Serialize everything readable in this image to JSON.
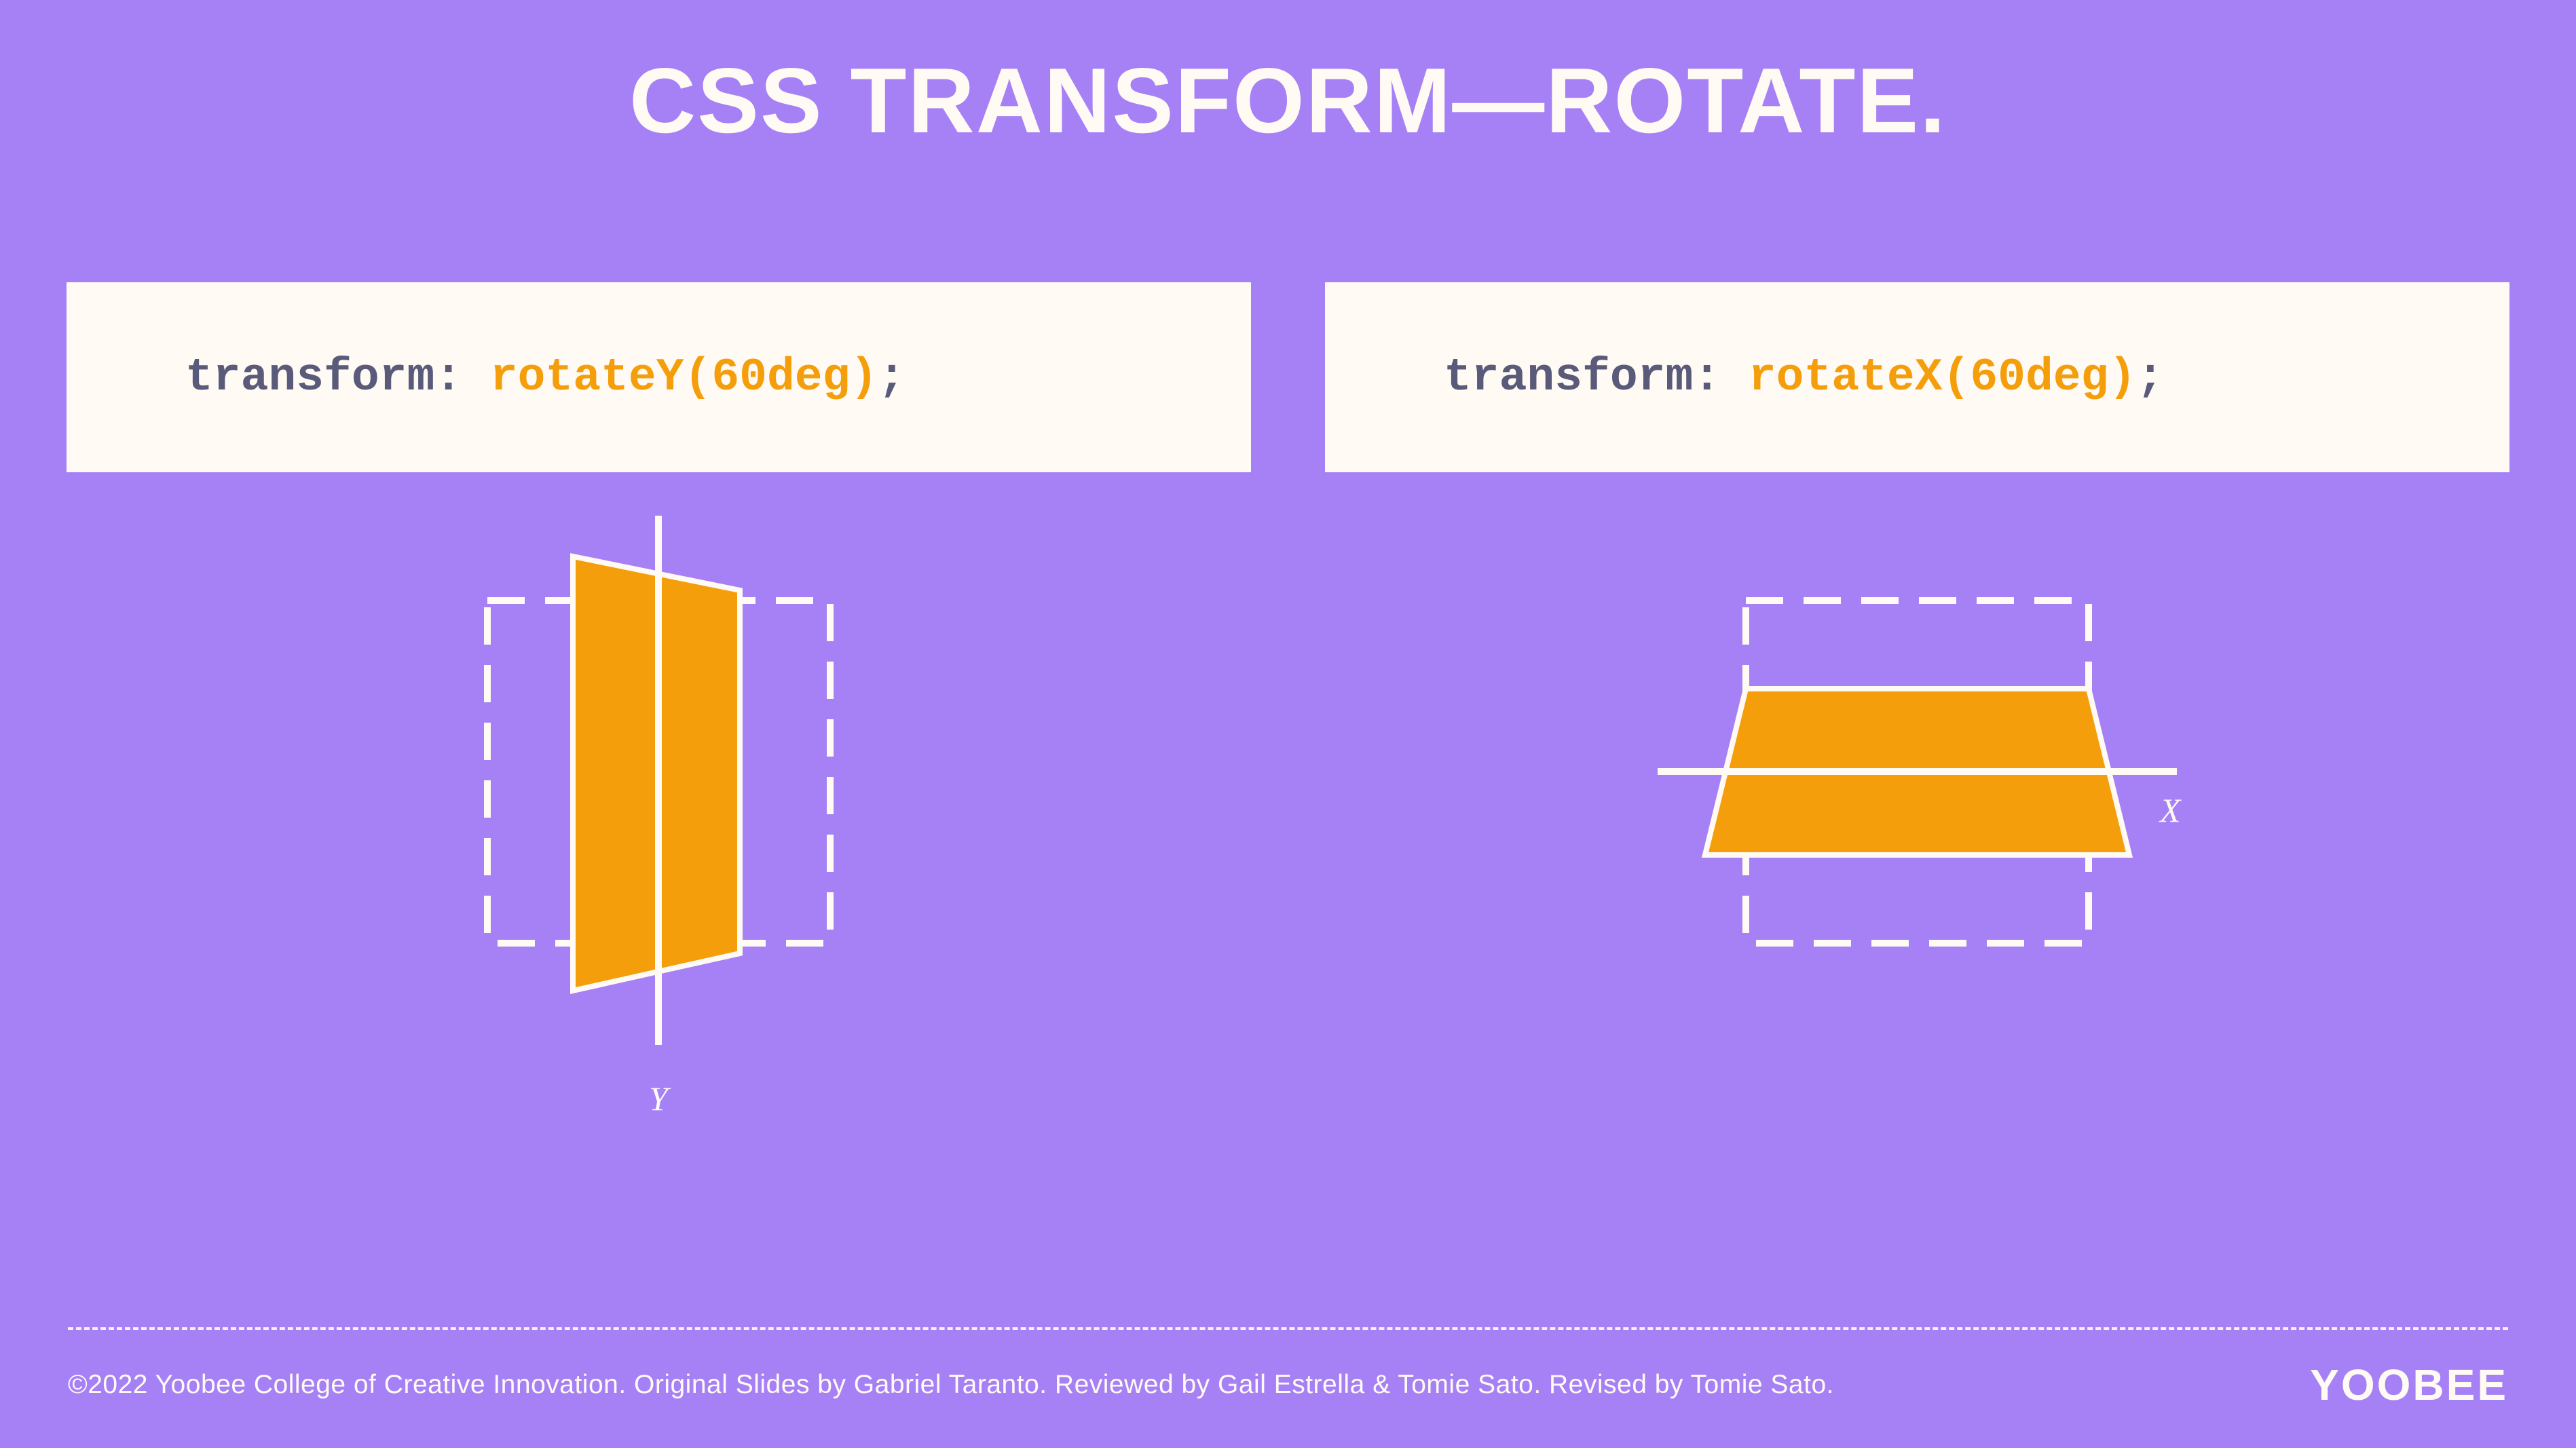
{
  "title": "CSS TRANSFORM—ROTATE.",
  "code_left": {
    "prop": "transform: ",
    "val": "rotateY(60deg)",
    "end": ";"
  },
  "code_right": {
    "prop": "transform: ",
    "val": "rotateX(60deg)",
    "end": ";"
  },
  "axis_left_label": "Y",
  "axis_right_label": "X",
  "footer": {
    "copyright": "©2022 Yoobee College of Creative Innovation.  Original Slides by Gabriel Taranto.  Reviewed by Gail Estrella & Tomie Sato.  Revised by Tomie Sato."
  },
  "logo": "YOOBEE",
  "colors": {
    "bg": "#a681f5",
    "panel": "#fffaf3",
    "accent": "#f59e0b",
    "code_muted": "#5a5a7a"
  }
}
